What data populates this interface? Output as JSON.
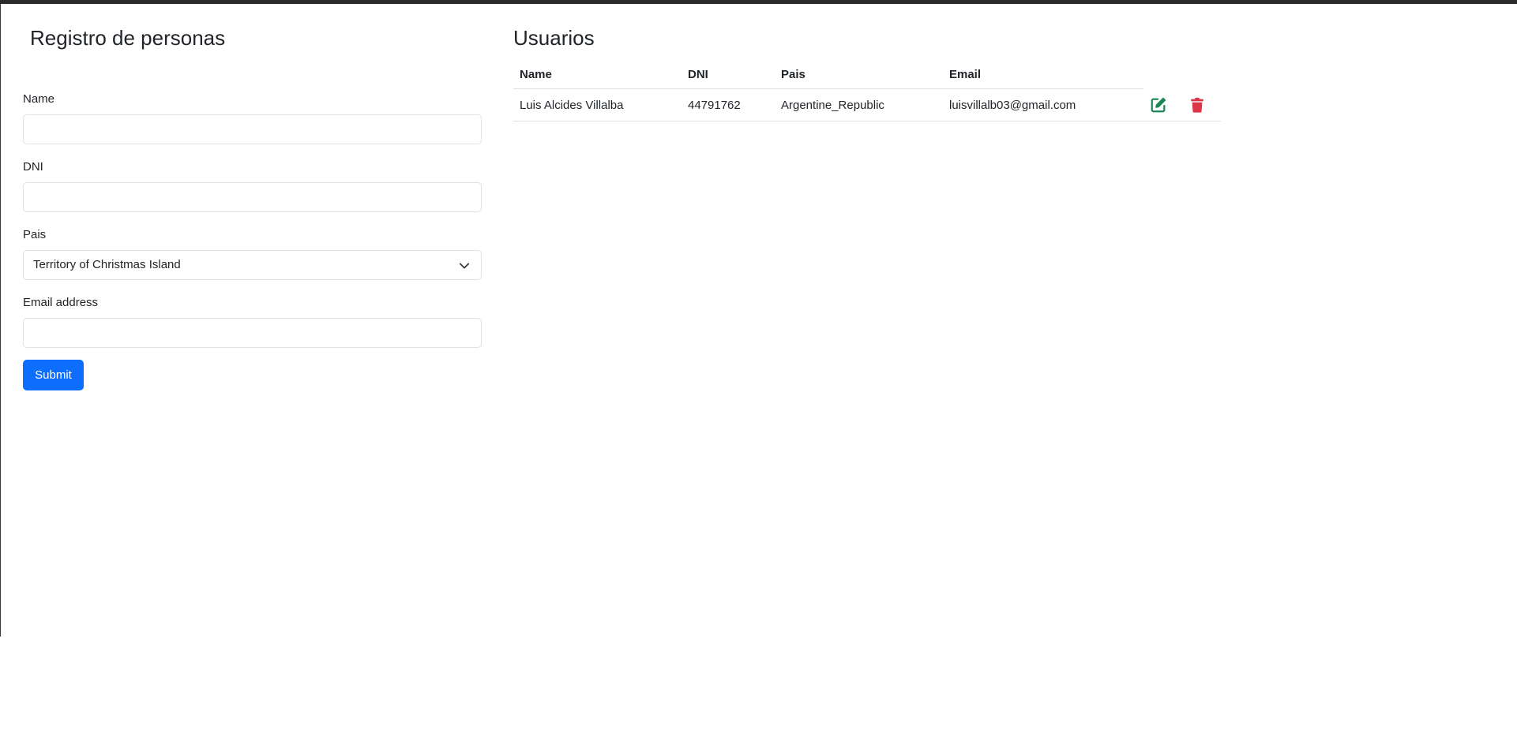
{
  "form": {
    "title": "Registro de personas",
    "name_label": "Name",
    "name_value": "",
    "dni_label": "DNI",
    "dni_value": "",
    "pais_label": "Pais",
    "pais_selected": "Territory of Christmas Island",
    "email_label": "Email address",
    "email_value": "",
    "submit_label": "Submit"
  },
  "users": {
    "title": "Usuarios",
    "columns": [
      "Name",
      "DNI",
      "Pais",
      "Email"
    ],
    "rows": [
      {
        "name": "Luis Alcides Villalba",
        "dni": "44791762",
        "pais": "Argentine_Republic",
        "email": "luisvillalb03@gmail.com",
        "edit_icon": "edit-icon",
        "delete_icon": "trash-icon"
      }
    ]
  },
  "colors": {
    "primary": "#0d6efd",
    "edit": "#198754",
    "delete": "#dc3545",
    "border": "#dee2e6"
  }
}
